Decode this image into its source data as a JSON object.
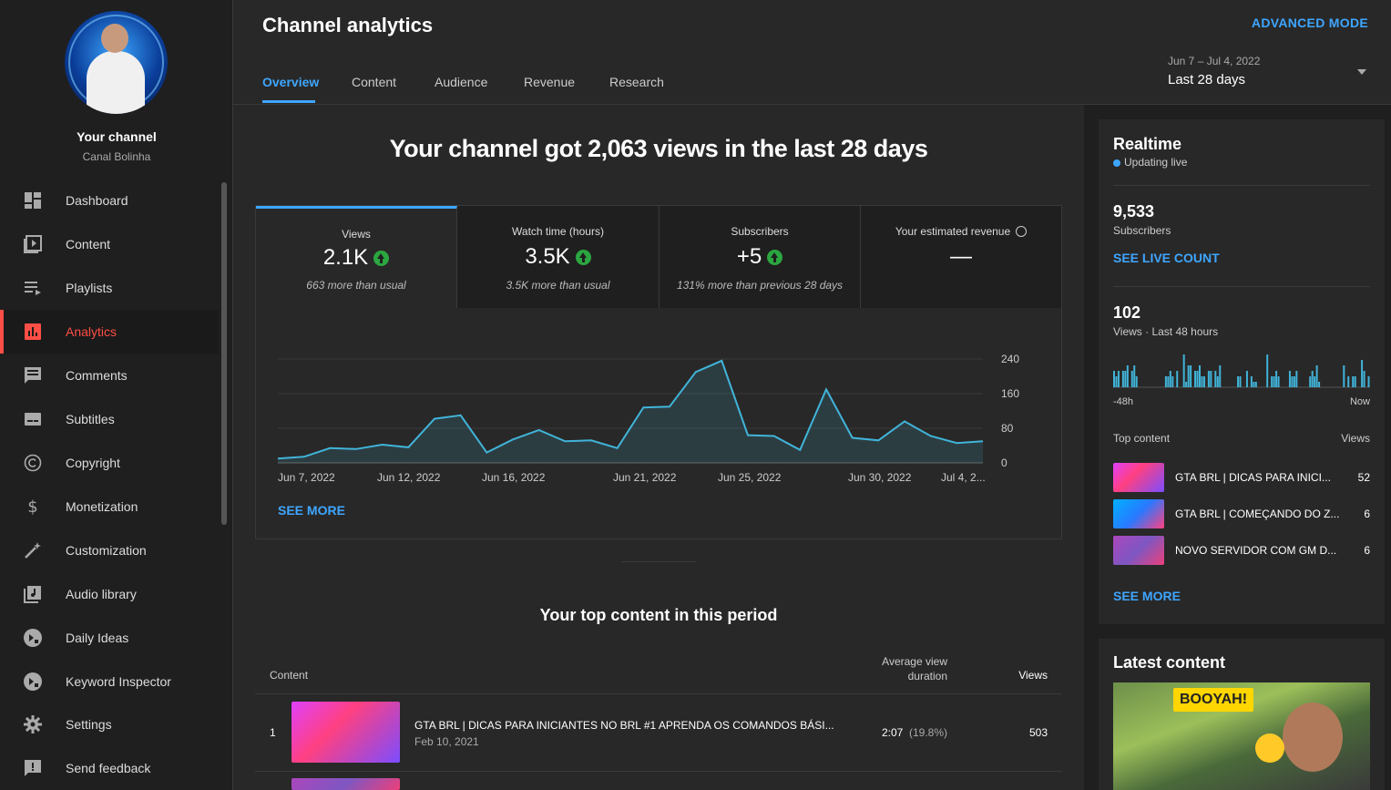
{
  "sidebar": {
    "channel_title": "Your channel",
    "channel_name": "Canal Bolinha",
    "items": [
      {
        "label": "Dashboard",
        "icon": "dashboard-icon"
      },
      {
        "label": "Content",
        "icon": "content-icon"
      },
      {
        "label": "Playlists",
        "icon": "playlists-icon"
      },
      {
        "label": "Analytics",
        "icon": "analytics-icon",
        "active": true
      },
      {
        "label": "Comments",
        "icon": "comments-icon"
      },
      {
        "label": "Subtitles",
        "icon": "subtitles-icon"
      },
      {
        "label": "Copyright",
        "icon": "copyright-icon"
      },
      {
        "label": "Monetization",
        "icon": "dollar-icon"
      },
      {
        "label": "Customization",
        "icon": "magic-wand-icon"
      },
      {
        "label": "Audio library",
        "icon": "audio-library-icon"
      },
      {
        "label": "Daily Ideas",
        "icon": "vidiq-icon"
      },
      {
        "label": "Keyword Inspector",
        "icon": "vidiq-icon"
      },
      {
        "label": "Settings",
        "icon": "gear-icon"
      },
      {
        "label": "Send feedback",
        "icon": "feedback-icon"
      }
    ]
  },
  "header": {
    "title": "Channel analytics",
    "advanced_mode": "ADVANCED MODE",
    "tabs": [
      "Overview",
      "Content",
      "Audience",
      "Revenue",
      "Research"
    ],
    "date_range": "Jun 7 – Jul 4, 2022",
    "date_label": "Last 28 days"
  },
  "main": {
    "headline": "Your channel got 2,063 views in the last 28 days",
    "metrics": [
      {
        "title": "Views",
        "value": "2.1K",
        "sub": "663 more than usual",
        "trend": "up"
      },
      {
        "title": "Watch time (hours)",
        "value": "3.5K",
        "sub": "3.5K more than usual",
        "trend": "up"
      },
      {
        "title": "Subscribers",
        "value": "+5",
        "sub": "131% more than previous 28 days",
        "trend": "up"
      },
      {
        "title": "Your estimated revenue",
        "value": "—",
        "sub": "",
        "trend": "none"
      }
    ],
    "see_more": "SEE MORE",
    "top_content_title": "Your top content in this period",
    "table": {
      "col_content": "Content",
      "col_avd": "Average view duration",
      "col_views": "Views",
      "rows": [
        {
          "rank": "1",
          "title": "GTA BRL | DICAS PARA INICIANTES NO BRL #1 APRENDA OS COMANDOS BÁSI...",
          "date": "Feb 10, 2021",
          "avd": "2:07",
          "avd_pct": "(19.8%)",
          "views": "503"
        }
      ]
    }
  },
  "chart_data": {
    "type": "area",
    "x_ticks": [
      "Jun 7, 2022",
      "Jun 12, 2022",
      "Jun 16, 2022",
      "Jun 21, 2022",
      "Jun 25, 2022",
      "Jun 30, 2022",
      "Jul 4, 2..."
    ],
    "y_ticks": [
      "240",
      "160",
      "80",
      "0"
    ],
    "ylim": [
      0,
      240
    ],
    "series": [
      {
        "values": [
          10,
          14,
          34,
          32,
          42,
          36,
          102,
          110,
          24,
          54,
          76,
          50,
          52,
          34,
          128,
          130,
          210,
          236,
          64,
          62,
          30,
          170,
          58,
          52,
          96,
          62,
          46,
          50
        ]
      }
    ],
    "grid": true,
    "line_color": "#41b4d9"
  },
  "realtime": {
    "title": "Realtime",
    "live": "Updating live",
    "subs_value": "9,533",
    "subs_label": "Subscribers",
    "see_live": "SEE LIVE COUNT",
    "views_value": "102",
    "views_label": "Views · Last 48 hours",
    "axis_left": "-48h",
    "axis_right": "Now",
    "bar_values": [
      3,
      2,
      3,
      0,
      3,
      3,
      4,
      0,
      3,
      4,
      2,
      0,
      0,
      0,
      0,
      0,
      0,
      0,
      0,
      0,
      0,
      0,
      0,
      2,
      2,
      3,
      2,
      0,
      3,
      0,
      0,
      6,
      1,
      4,
      4,
      0,
      3,
      3,
      4,
      2,
      2,
      0,
      3,
      3,
      0,
      3,
      2,
      4,
      0,
      0,
      0,
      0,
      0,
      0,
      0,
      2,
      2,
      0,
      0,
      3,
      0,
      2,
      1,
      1,
      0,
      0,
      0,
      0,
      6,
      0,
      2,
      2,
      3,
      2,
      0,
      0,
      0,
      0,
      3,
      2,
      2,
      3,
      0,
      0,
      0,
      0,
      0,
      2,
      3,
      2,
      4,
      1,
      0,
      0,
      0,
      0,
      0,
      0,
      0,
      0,
      0,
      0,
      4,
      0,
      2,
      0,
      2,
      2,
      0,
      0,
      5,
      3,
      0,
      2
    ],
    "bar_color": "#41b4d9",
    "top_content_label": "Top content",
    "views_col": "Views",
    "top_content": [
      {
        "title": "GTA BRL | DICAS PARA INICI...",
        "views": "52"
      },
      {
        "title": "GTA BRL | COMEÇANDO DO Z...",
        "views": "6"
      },
      {
        "title": "NOVO SERVIDOR COM GM D...",
        "views": "6"
      }
    ],
    "see_more": "SEE MORE"
  },
  "latest": {
    "title": "Latest content",
    "thumb_text": "BOOYAH!"
  }
}
